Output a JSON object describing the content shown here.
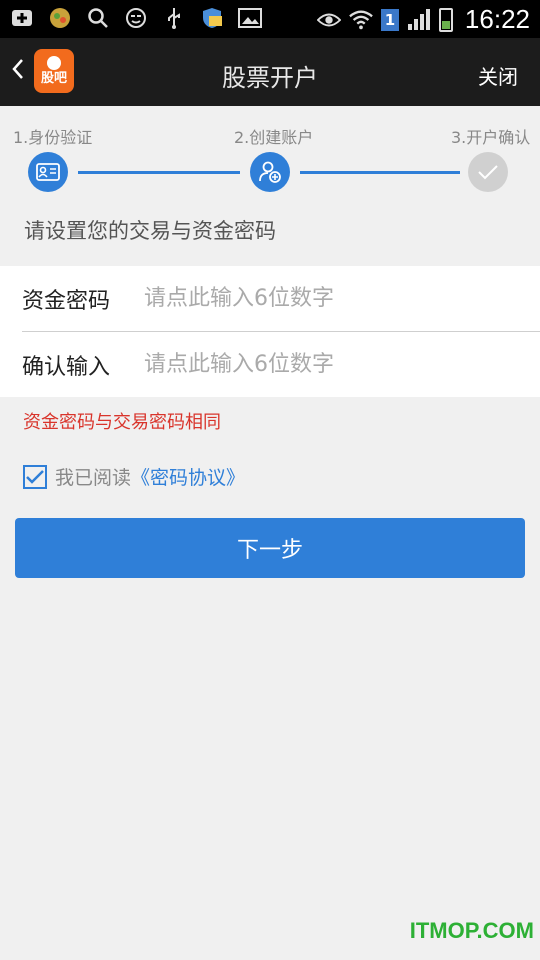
{
  "status_bar": {
    "time": "16:22",
    "sim_number": "1"
  },
  "header": {
    "back_icon": "chevron-left-icon",
    "logo_text": "股吧",
    "title": "股票开户",
    "close_label": "关闭"
  },
  "steps": [
    {
      "label": "1.身份验证",
      "state": "done",
      "icon": "id-card-icon"
    },
    {
      "label": "2.创建账户",
      "state": "current",
      "icon": "add-user-icon"
    },
    {
      "label": "3.开户确认",
      "state": "pending",
      "icon": "check-icon"
    }
  ],
  "colors": {
    "accent": "#2f7fd8",
    "warning": "#d9342b",
    "header_bg": "#1c1c1c",
    "logo_bg": "#f26b1d"
  },
  "form": {
    "hint": "请设置您的交易与资金密码",
    "fund_password": {
      "label": "资金密码",
      "placeholder": "请点此输入6位数字"
    },
    "confirm_password": {
      "label": "确认输入",
      "placeholder": "请点此输入6位数字"
    },
    "warning": "资金密码与交易密码相同"
  },
  "agreement": {
    "checked": true,
    "text": "我已阅读",
    "link": "《密码协议》"
  },
  "next_button": "下一步",
  "watermark": "ITMOP.COM"
}
